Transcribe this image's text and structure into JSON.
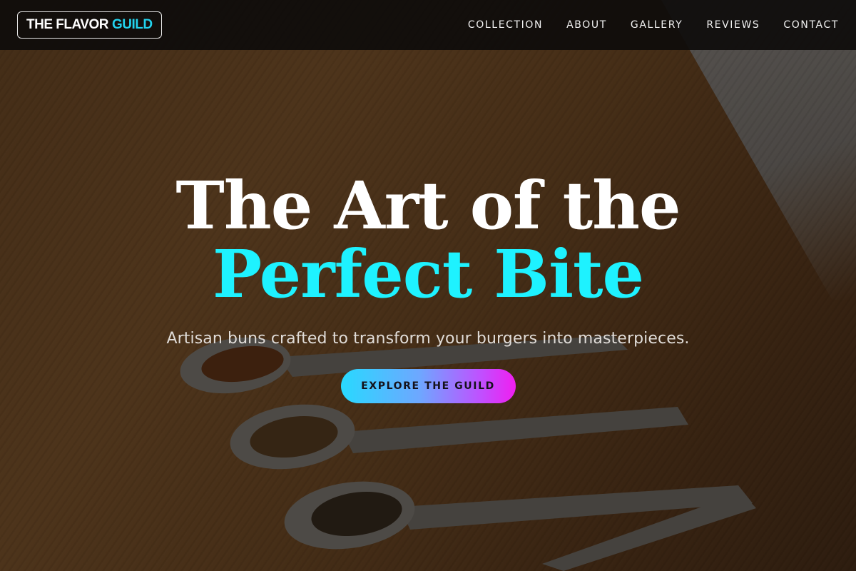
{
  "brand": {
    "name_part1": "THE FLAVOR",
    "name_part2": "GUILD",
    "accent_color": "#22d3ee"
  },
  "nav": {
    "items": [
      {
        "label": "COLLECTION"
      },
      {
        "label": "ABOUT"
      },
      {
        "label": "GALLERY"
      },
      {
        "label": "REVIEWS"
      },
      {
        "label": "CONTACT"
      }
    ]
  },
  "hero": {
    "title_line1": "The Art of the",
    "title_line2": "Perfect Bite",
    "title_highlight_color": "#1ef2ff",
    "subtitle": "Artisan buns crafted to transform your burgers into masterpieces.",
    "cta_label": "EXPLORE THE GUILD",
    "cta_gradient": [
      "#28d9ff",
      "#f01ef0"
    ]
  }
}
